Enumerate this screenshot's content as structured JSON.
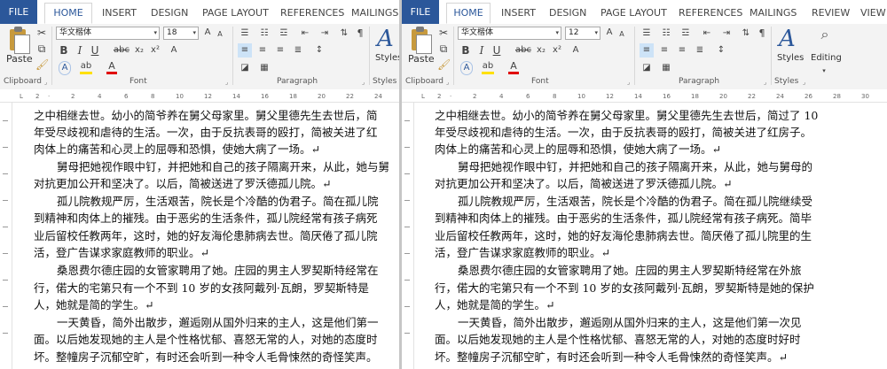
{
  "left": {
    "tabs": {
      "file": "FILE",
      "home": "HOME",
      "insert": "INSERT",
      "design": "DESIGN",
      "page_layout": "PAGE LAYOUT",
      "references": "REFERENCES",
      "mailings": "MAILINGS"
    },
    "clipboard": {
      "paste": "Paste",
      "group": "Clipboard"
    },
    "font": {
      "name": "华文楷体",
      "size": "18",
      "group": "Font"
    },
    "paragraph": {
      "group": "Paragraph"
    },
    "styles": {
      "label": "Styles",
      "group": "Styles"
    },
    "lines": [
      "之中相继去世。幼小的简爷养在舅父母家里。舅父里德先生去世后，简",
      "年受尽歧视和虐待的生活。一次，由于反抗表哥的殴打，简被关进了红",
      "肉体上的痛苦和心灵上的屈辱和恐惧，使她大病了一场。↵",
      "舅母把她视作眼中钉，并把她和自己的孩子隔离开来，从此，她与舅",
      "对抗更加公开和坚决了。以后，简被送进了罗沃德孤儿院。↵",
      "孤儿院教规严厉，生活艰苦，院长是个冷酷的伪君子。简在孤儿院",
      "到精神和肉体上的摧残。由于恶劣的生活条件，孤儿院经常有孩子病死",
      "业后留校任教两年，这时，她的好友海伦患肺病去世。简厌倦了孤儿院",
      "活，登广告谋求家庭教师的职业。↵",
      "桑恩费尔德庄园的女管家聘用了她。庄园的男主人罗契斯特经常在",
      "行，偌大的宅第只有一个不到 10 岁的女孩阿戴列·瓦朗，罗契斯特是",
      "人，她就是简的学生。↵",
      "一天黄昏，简外出散步，邂逅刚从国外归来的主人，这是他们第一",
      "面。以后她发现她的主人是个性格忧郁、喜怒无常的人，对她的态度时",
      "坏。整幢房子沉郁空旷，有时还会听到一种令人毛骨悚然的奇怪笑声。"
    ]
  },
  "right": {
    "tabs": {
      "file": "FILE",
      "home": "HOME",
      "insert": "INSERT",
      "design": "DESIGN",
      "page_layout": "PAGE LAYOUT",
      "references": "REFERENCES",
      "mailings": "MAILINGS",
      "review": "REVIEW",
      "view": "VIEW"
    },
    "clipboard": {
      "paste": "Paste",
      "group": "Clipboard"
    },
    "font": {
      "name": "华文楷体",
      "size": "12",
      "group": "Font"
    },
    "paragraph": {
      "group": "Paragraph"
    },
    "styles": {
      "label": "Styles",
      "group": "Styles"
    },
    "editing": {
      "label": "Editing"
    },
    "lines": [
      "之中相继去世。幼小的简爷养在舅父母家里。舅父里德先生去世后，简过了 10",
      "年受尽歧视和虐待的生活。一次，由于反抗表哥的殴打，简被关进了红房子。",
      "肉体上的痛苦和心灵上的屈辱和恐惧，使她大病了一场。↵",
      "舅母把她视作眼中钉，并把她和自己的孩子隔离开来，从此，她与舅母的",
      "对抗更加公开和坚决了。以后，简被送进了罗沃德孤儿院。↵",
      "孤儿院教规严厉，生活艰苦，院长是个冷酷的伪君子。简在孤儿院继续受",
      "到精神和肉体上的摧残。由于恶劣的生活条件，孤儿院经常有孩子病死。简毕",
      "业后留校任教两年，这时，她的好友海伦患肺病去世。简厌倦了孤儿院里的生",
      "活，登广告谋求家庭教师的职业。↵",
      "桑恩费尔德庄园的女管家聘用了她。庄园的男主人罗契斯特经常在外旅",
      "行，偌大的宅第只有一个不到 10 岁的女孩阿戴列·瓦朗，罗契斯特是她的保护",
      "人，她就是简的学生。↵",
      "一天黄昏，简外出散步，邂逅刚从国外归来的主人，这是他们第一次见",
      "面。以后她发现她的主人是个性格忧郁、喜怒无常的人，对她的态度时好时",
      "坏。整幢房子沉郁空旷，有时还会听到一种令人毛骨悚然的奇怪笑声。↵"
    ]
  }
}
